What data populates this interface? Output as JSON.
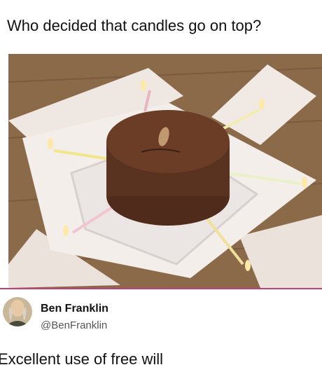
{
  "post": {
    "caption": "Who decided that candles go on top?",
    "photo_alt": "chocolate cake with candles stuck into its sides"
  },
  "reply": {
    "author_name": "Ben Franklin",
    "author_handle": "@BenFranklin",
    "text": "Excellent use of free will"
  },
  "colors": {
    "divider": "#c2407a",
    "cake": "#5a3220",
    "table": "#8b6a4a"
  }
}
